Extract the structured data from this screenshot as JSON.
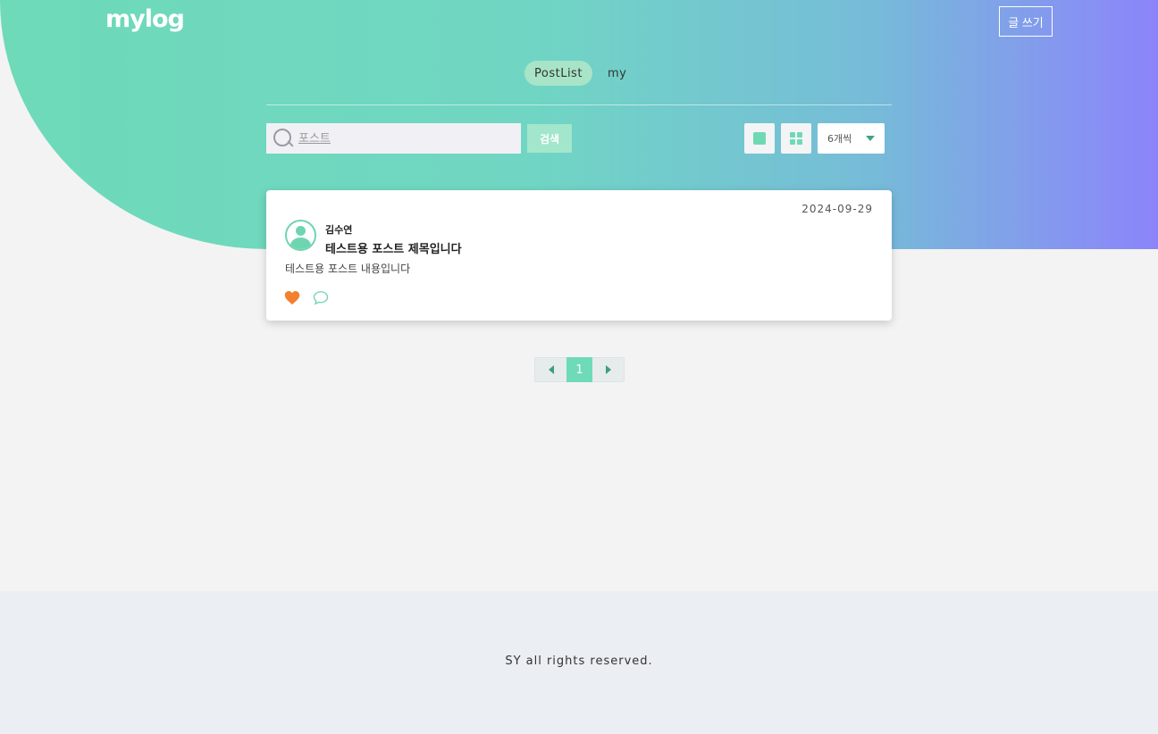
{
  "header": {
    "logo": "mylog",
    "write_button": "글 쓰기"
  },
  "nav": {
    "tabs": [
      {
        "label": "PostList",
        "active": true
      },
      {
        "label": "my",
        "active": false
      }
    ]
  },
  "toolbar": {
    "search_placeholder": "포스트",
    "search_button": "검색",
    "per_page_selected": "6개씩",
    "view_modes": [
      "single-view-icon",
      "grid-view-icon"
    ]
  },
  "posts": [
    {
      "author": "김수연",
      "date": "2024-09-29",
      "title": "테스트용 포스트 제목입니다",
      "content": "테스트용 포스트 내용입니다",
      "liked": true
    }
  ],
  "pagination": {
    "current_page": "1"
  },
  "footer": {
    "text": "SY all rights reserved."
  },
  "colors": {
    "accent": "#6edab8",
    "gradient_end": "#8c84fb",
    "like": "#f4802f"
  }
}
